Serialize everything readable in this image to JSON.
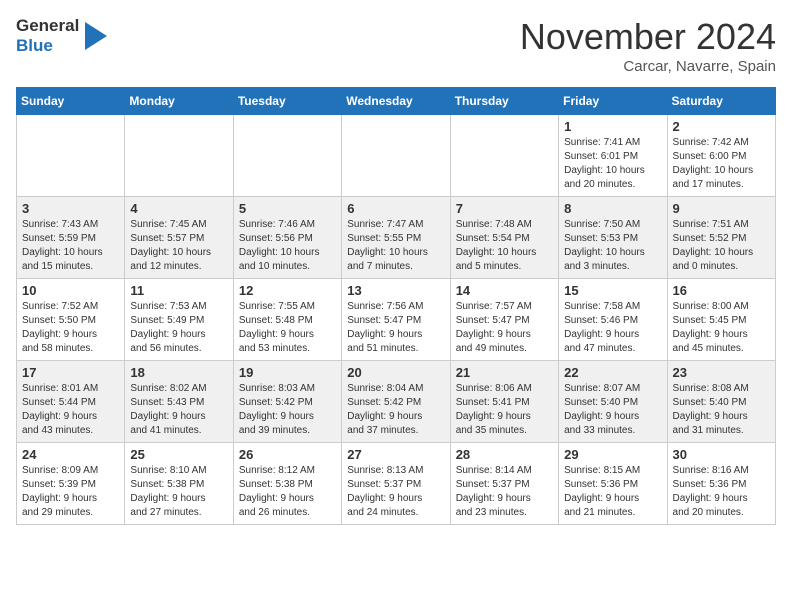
{
  "header": {
    "logo_line1": "General",
    "logo_line2": "Blue",
    "month": "November 2024",
    "location": "Carcar, Navarre, Spain"
  },
  "days_of_week": [
    "Sunday",
    "Monday",
    "Tuesday",
    "Wednesday",
    "Thursday",
    "Friday",
    "Saturday"
  ],
  "weeks": [
    [
      {
        "day": "",
        "info": ""
      },
      {
        "day": "",
        "info": ""
      },
      {
        "day": "",
        "info": ""
      },
      {
        "day": "",
        "info": ""
      },
      {
        "day": "",
        "info": ""
      },
      {
        "day": "1",
        "info": "Sunrise: 7:41 AM\nSunset: 6:01 PM\nDaylight: 10 hours\nand 20 minutes."
      },
      {
        "day": "2",
        "info": "Sunrise: 7:42 AM\nSunset: 6:00 PM\nDaylight: 10 hours\nand 17 minutes."
      }
    ],
    [
      {
        "day": "3",
        "info": "Sunrise: 7:43 AM\nSunset: 5:59 PM\nDaylight: 10 hours\nand 15 minutes."
      },
      {
        "day": "4",
        "info": "Sunrise: 7:45 AM\nSunset: 5:57 PM\nDaylight: 10 hours\nand 12 minutes."
      },
      {
        "day": "5",
        "info": "Sunrise: 7:46 AM\nSunset: 5:56 PM\nDaylight: 10 hours\nand 10 minutes."
      },
      {
        "day": "6",
        "info": "Sunrise: 7:47 AM\nSunset: 5:55 PM\nDaylight: 10 hours\nand 7 minutes."
      },
      {
        "day": "7",
        "info": "Sunrise: 7:48 AM\nSunset: 5:54 PM\nDaylight: 10 hours\nand 5 minutes."
      },
      {
        "day": "8",
        "info": "Sunrise: 7:50 AM\nSunset: 5:53 PM\nDaylight: 10 hours\nand 3 minutes."
      },
      {
        "day": "9",
        "info": "Sunrise: 7:51 AM\nSunset: 5:52 PM\nDaylight: 10 hours\nand 0 minutes."
      }
    ],
    [
      {
        "day": "10",
        "info": "Sunrise: 7:52 AM\nSunset: 5:50 PM\nDaylight: 9 hours\nand 58 minutes."
      },
      {
        "day": "11",
        "info": "Sunrise: 7:53 AM\nSunset: 5:49 PM\nDaylight: 9 hours\nand 56 minutes."
      },
      {
        "day": "12",
        "info": "Sunrise: 7:55 AM\nSunset: 5:48 PM\nDaylight: 9 hours\nand 53 minutes."
      },
      {
        "day": "13",
        "info": "Sunrise: 7:56 AM\nSunset: 5:47 PM\nDaylight: 9 hours\nand 51 minutes."
      },
      {
        "day": "14",
        "info": "Sunrise: 7:57 AM\nSunset: 5:47 PM\nDaylight: 9 hours\nand 49 minutes."
      },
      {
        "day": "15",
        "info": "Sunrise: 7:58 AM\nSunset: 5:46 PM\nDaylight: 9 hours\nand 47 minutes."
      },
      {
        "day": "16",
        "info": "Sunrise: 8:00 AM\nSunset: 5:45 PM\nDaylight: 9 hours\nand 45 minutes."
      }
    ],
    [
      {
        "day": "17",
        "info": "Sunrise: 8:01 AM\nSunset: 5:44 PM\nDaylight: 9 hours\nand 43 minutes."
      },
      {
        "day": "18",
        "info": "Sunrise: 8:02 AM\nSunset: 5:43 PM\nDaylight: 9 hours\nand 41 minutes."
      },
      {
        "day": "19",
        "info": "Sunrise: 8:03 AM\nSunset: 5:42 PM\nDaylight: 9 hours\nand 39 minutes."
      },
      {
        "day": "20",
        "info": "Sunrise: 8:04 AM\nSunset: 5:42 PM\nDaylight: 9 hours\nand 37 minutes."
      },
      {
        "day": "21",
        "info": "Sunrise: 8:06 AM\nSunset: 5:41 PM\nDaylight: 9 hours\nand 35 minutes."
      },
      {
        "day": "22",
        "info": "Sunrise: 8:07 AM\nSunset: 5:40 PM\nDaylight: 9 hours\nand 33 minutes."
      },
      {
        "day": "23",
        "info": "Sunrise: 8:08 AM\nSunset: 5:40 PM\nDaylight: 9 hours\nand 31 minutes."
      }
    ],
    [
      {
        "day": "24",
        "info": "Sunrise: 8:09 AM\nSunset: 5:39 PM\nDaylight: 9 hours\nand 29 minutes."
      },
      {
        "day": "25",
        "info": "Sunrise: 8:10 AM\nSunset: 5:38 PM\nDaylight: 9 hours\nand 27 minutes."
      },
      {
        "day": "26",
        "info": "Sunrise: 8:12 AM\nSunset: 5:38 PM\nDaylight: 9 hours\nand 26 minutes."
      },
      {
        "day": "27",
        "info": "Sunrise: 8:13 AM\nSunset: 5:37 PM\nDaylight: 9 hours\nand 24 minutes."
      },
      {
        "day": "28",
        "info": "Sunrise: 8:14 AM\nSunset: 5:37 PM\nDaylight: 9 hours\nand 23 minutes."
      },
      {
        "day": "29",
        "info": "Sunrise: 8:15 AM\nSunset: 5:36 PM\nDaylight: 9 hours\nand 21 minutes."
      },
      {
        "day": "30",
        "info": "Sunrise: 8:16 AM\nSunset: 5:36 PM\nDaylight: 9 hours\nand 20 minutes."
      }
    ]
  ]
}
